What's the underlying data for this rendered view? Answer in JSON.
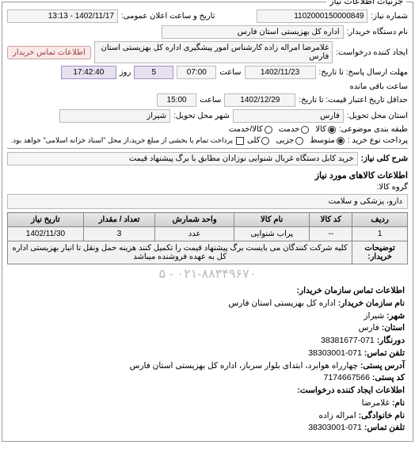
{
  "panel_title": "جزئیات اطلاعات نیاز",
  "header": {
    "req_no_label": "شماره نیاز:",
    "req_no": "1102000150000849",
    "public_date_label": "تاریخ و ساعت اعلان عمومی:",
    "public_date": "1402/11/17 - 13:13"
  },
  "requester": {
    "unit_label": "نام دستگاه خریدار:",
    "unit": "اداره کل بهزیستی استان فارس",
    "creator_label": "ایجاد کننده درخواست:",
    "creator": "غلامرضا امراله زاده کارشناس امور پیشگیری اداره کل بهزیستی استان فارس",
    "contact_btn": "اطلاعات تماس خریدار"
  },
  "times": {
    "deadline_recv_label": "مهلت ارسال پاسخ: تا تاریخ:",
    "deadline_recv_date": "1402/11/23",
    "deadline_recv_time_label": "ساعت",
    "deadline_recv_time": "07:00",
    "remaining_days": "5",
    "remaining_hms": "17:42:40",
    "remaining_suffix": "ساعت باقی مانده",
    "valid_until_label": "حداقل تاریخ اعتبار قیمت: تا تاریخ:",
    "valid_until_date": "1402/12/29",
    "valid_until_time_label": "ساعت",
    "valid_until_time": "15:00"
  },
  "delivery": {
    "province_label": "استان محل تحویل:",
    "province": "فارس",
    "city_label": "شهر محل تحویل:",
    "city": "شیراز"
  },
  "classification": {
    "label": "طبقه بندی موضوعی:",
    "options": {
      "goods": "کالا",
      "service": "خدمت",
      "goods_service": "کالا/خدمت"
    }
  },
  "purchase_type": {
    "label": "پرداخت نوع خرید :",
    "options": {
      "medium": "متوسط",
      "small": "جزیی",
      "large": "کلی"
    },
    "note": "پرداخت تمام یا بخشی از مبلغ خرید،از محل \"اسناد خزانه اسلامی\" خواهد بود."
  },
  "subject": {
    "label": "شرح کلی نیاز:",
    "text": "خرید کابل دستگاه غربال شنوایی نوزادان مطابق با برگ پیشنهاد قیمت"
  },
  "items_section": {
    "title": "اطلاعات کالاهای مورد نیاز",
    "group_label": "گروه کالا:",
    "group": "دارو، پزشکی و سلامت",
    "columns": {
      "row": "ردیف",
      "code": "کد کالا",
      "name": "نام کالا",
      "unit": "واحد شمارش",
      "qty": "تعداد / مقدار",
      "due": "تاریخ نیاز"
    },
    "rows": [
      {
        "row": "1",
        "code": "--",
        "name": "پراب شنوایی",
        "unit": "عدد",
        "qty": "3",
        "due": "1402/11/30"
      }
    ],
    "notes_label": "توضیحات خریدار:",
    "notes": "کلیه شرکت کنندگان می بایست برگ پیشنهاد قیمت را تکمیل کنند هزینه حمل ونقل تا انبار بهزیستی اداره کل به عهده فروشنده میباشد"
  },
  "phones_strip": "۰۲۱-۸۸۳۴۹۶۷۰ - ۵",
  "contacts": {
    "title": "اطلاعات تماس سازمان خریدار:",
    "org_label": "نام سازمان خریدار:",
    "org": "اداره کل بهزیستی استان فارس",
    "city_label": "شهر:",
    "city": "شیراز",
    "province_label": "استان:",
    "province": "فارس",
    "fax_label": "دورنگار:",
    "fax": "071-38381677",
    "phone_label": "تلفن تماس:",
    "phone": "071-38303001",
    "address_label": "آدرس پستی:",
    "address": "چهارراه هوابرد، ابتدای بلوار سرباز، اداره کل بهزیستی استان فارس",
    "postal_label": "کد پستی:",
    "postal": "7174667566",
    "creator_section": "اطلاعات ایجاد کننده درخواست:",
    "name_label": "نام:",
    "name": "غلامرضا",
    "lname_label": "نام خانوادگی:",
    "lname": "امراله زاده",
    "cphone_label": "تلفن تماس:",
    "cphone": "071-38303001"
  }
}
